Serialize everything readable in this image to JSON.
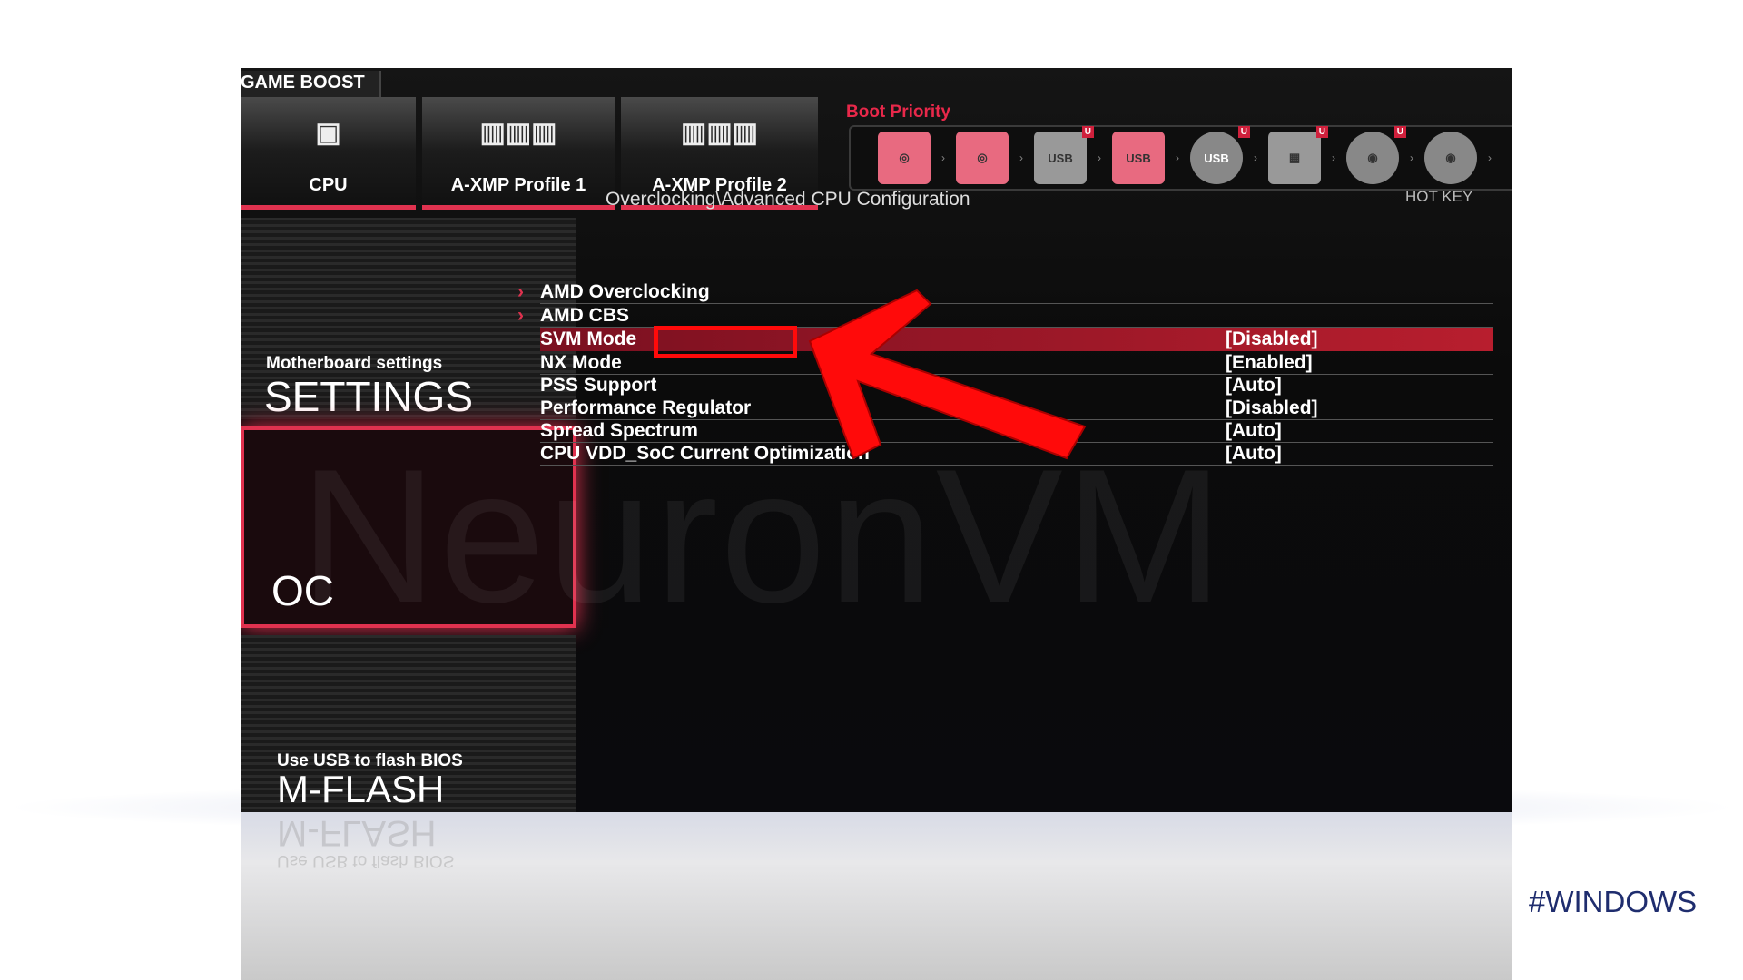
{
  "top": {
    "game_boost": "GAME BOOST",
    "tabs": [
      {
        "label": "CPU",
        "icon": "cpu-icon"
      },
      {
        "label": "A-XMP Profile 1",
        "icon": "memory-icon"
      },
      {
        "label": "A-XMP Profile 2",
        "icon": "memory-icon"
      }
    ],
    "boot_priority": {
      "label": "Boot Priority",
      "devices": [
        {
          "icon": "hdd-icon"
        },
        {
          "icon": "hdd-icon"
        },
        {
          "icon": "usb-drive-icon",
          "text": "USB",
          "badge": "U"
        },
        {
          "icon": "usb-hdd-icon",
          "text": "USB"
        },
        {
          "icon": "usb-cd-icon",
          "text": "USB",
          "badge": "U"
        },
        {
          "icon": "network-icon",
          "badge": "U"
        },
        {
          "icon": "optical-disc-icon",
          "badge": "U"
        },
        {
          "icon": "optical-disc-icon"
        }
      ]
    }
  },
  "sidebar": {
    "settings": {
      "sub": "Motherboard settings",
      "title": "SETTINGS"
    },
    "oc": {
      "title": "OC"
    },
    "mflash": {
      "sub": "Use USB to flash BIOS",
      "title": "M-FLASH"
    }
  },
  "main": {
    "breadcrumb": "Overclocking\\Advanced CPU Configuration",
    "hotkey": "HOT KEY",
    "rows": [
      {
        "name": "AMD Overclocking",
        "value": ""
      },
      {
        "name": "AMD CBS",
        "value": ""
      },
      {
        "name": "SVM Mode",
        "value": "[Disabled]"
      },
      {
        "name": "NX Mode",
        "value": "[Enabled]"
      },
      {
        "name": "PSS Support",
        "value": "[Auto]"
      },
      {
        "name": "Performance Regulator",
        "value": "[Disabled]"
      },
      {
        "name": "Spread Spectrum",
        "value": "[Auto]"
      },
      {
        "name": "CPU VDD_SoC Current Optimization",
        "value": "[Auto]"
      }
    ]
  },
  "watermark": "NeuronVM",
  "tag": "#WINDOWS",
  "colors": {
    "accent": "#e0324f",
    "annotation": "#ff0a0a",
    "tag": "#1f2d6e"
  }
}
